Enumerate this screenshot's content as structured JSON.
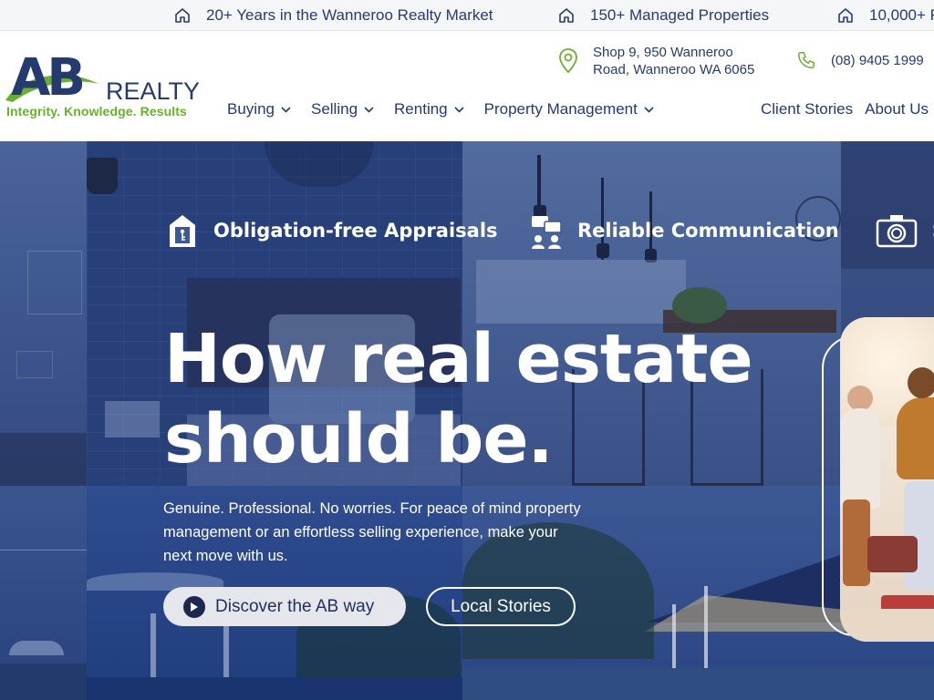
{
  "ticker": {
    "items": [
      {
        "icon": "home-icon",
        "text": "20+ Years in the Wanneroo Realty Market"
      },
      {
        "icon": "home-icon",
        "text": "150+ Managed Properties"
      },
      {
        "icon": "home-icon",
        "text": "10,000+ F"
      }
    ]
  },
  "header": {
    "logo": {
      "letters": "AB",
      "word": "REALTY",
      "tagline": "Integrity. Knowledge. Results"
    },
    "address_line1": "Shop 9, 950 Wanneroo",
    "address_line2": "Road, Wanneroo WA 6065",
    "phone": "(08) 9405 1999",
    "nav": [
      {
        "label": "Buying"
      },
      {
        "label": "Selling"
      },
      {
        "label": "Renting"
      },
      {
        "label": "Property Management"
      }
    ],
    "nav_right": [
      {
        "label": "Client Stories"
      },
      {
        "label": "About Us"
      }
    ]
  },
  "hero": {
    "features": [
      {
        "icon": "appraisal-icon",
        "label": "Obligation-free Appraisals"
      },
      {
        "icon": "chat-icon",
        "label": "Reliable Communication"
      },
      {
        "icon": "camera-icon",
        "label": "S"
      }
    ],
    "headline_line1": "How real estate",
    "headline_line2": "should be.",
    "subtext": "Genuine. Professional. No worries. For peace of mind property management or an effortless selling experience, make your next move with us.",
    "primary_button": "Discover the AB way",
    "secondary_button": "Local Stories"
  },
  "colors": {
    "brand_navy": "#253a6e",
    "brand_green": "#68b02f",
    "hero_overlay": "#27407a",
    "ticker_bg": "#f5f6f8"
  }
}
